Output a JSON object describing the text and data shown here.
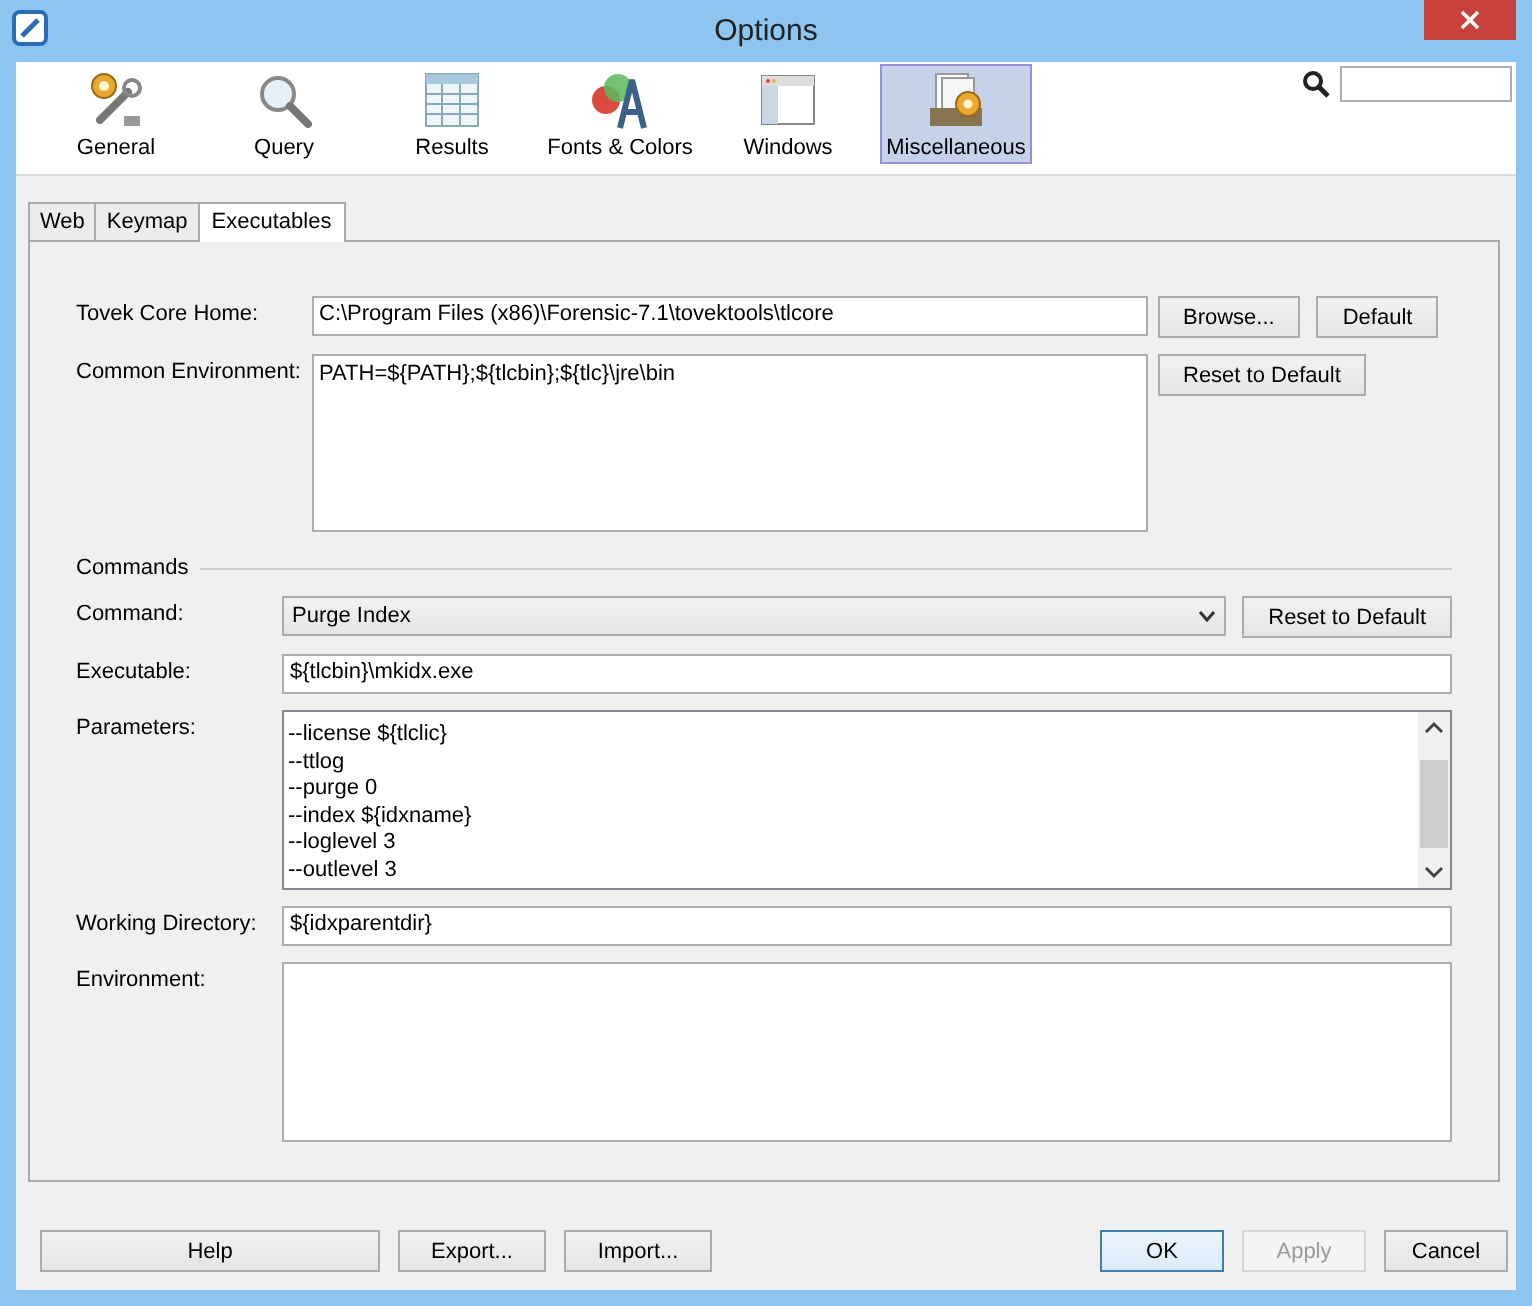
{
  "window": {
    "title": "Options"
  },
  "categories": [
    {
      "kind": "general",
      "label": "General",
      "selected": false
    },
    {
      "kind": "query",
      "label": "Query",
      "selected": false
    },
    {
      "kind": "results",
      "label": "Results",
      "selected": false
    },
    {
      "kind": "fonts",
      "label": "Fonts & Colors",
      "selected": false
    },
    {
      "kind": "windows",
      "label": "Windows",
      "selected": false
    },
    {
      "kind": "misc",
      "label": "Miscellaneous",
      "selected": true
    }
  ],
  "tabs": [
    {
      "label": "Web",
      "selected": false
    },
    {
      "label": "Keymap",
      "selected": false
    },
    {
      "label": "Executables",
      "selected": true
    }
  ],
  "core_home": {
    "label": "Tovek Core Home:",
    "value": "C:\\Program Files (x86)\\Forensic-7.1\\tovektools\\tlcore",
    "buttons": [
      "Browse...",
      "Default"
    ]
  },
  "common_environment": {
    "label": "Common Environment:",
    "value": "PATH=${PATH};${tlcbin};${tlc}\\jre\\bin",
    "button": "Reset to Default"
  },
  "commands": {
    "heading": "Commands",
    "command": {
      "label": "Command:",
      "value": "Purge Index",
      "button": "Reset to Default"
    },
    "executable": {
      "label": "Executable:",
      "value": "${tlcbin}\\mkidx.exe"
    },
    "parameters": {
      "label": "Parameters:",
      "lines": [
        "--license ${tlclic}",
        "--ttlog",
        "--purge 0",
        "--index ${idxname}",
        "--loglevel 3",
        "--outlevel 3"
      ]
    },
    "working_directory": {
      "label": "Working Directory:",
      "value": "${idxparentdir}"
    },
    "environment": {
      "label": "Environment:"
    }
  },
  "buttons": [
    {
      "label": "Help",
      "disabled": false,
      "default": false
    },
    {
      "label": "Export...",
      "disabled": false,
      "default": false
    },
    {
      "label": "Import...",
      "disabled": false,
      "default": false
    },
    {
      "label": "OK",
      "disabled": false,
      "default": true
    },
    {
      "label": "Apply",
      "disabled": true,
      "default": false
    },
    {
      "label": "Cancel",
      "disabled": false,
      "default": false
    }
  ]
}
